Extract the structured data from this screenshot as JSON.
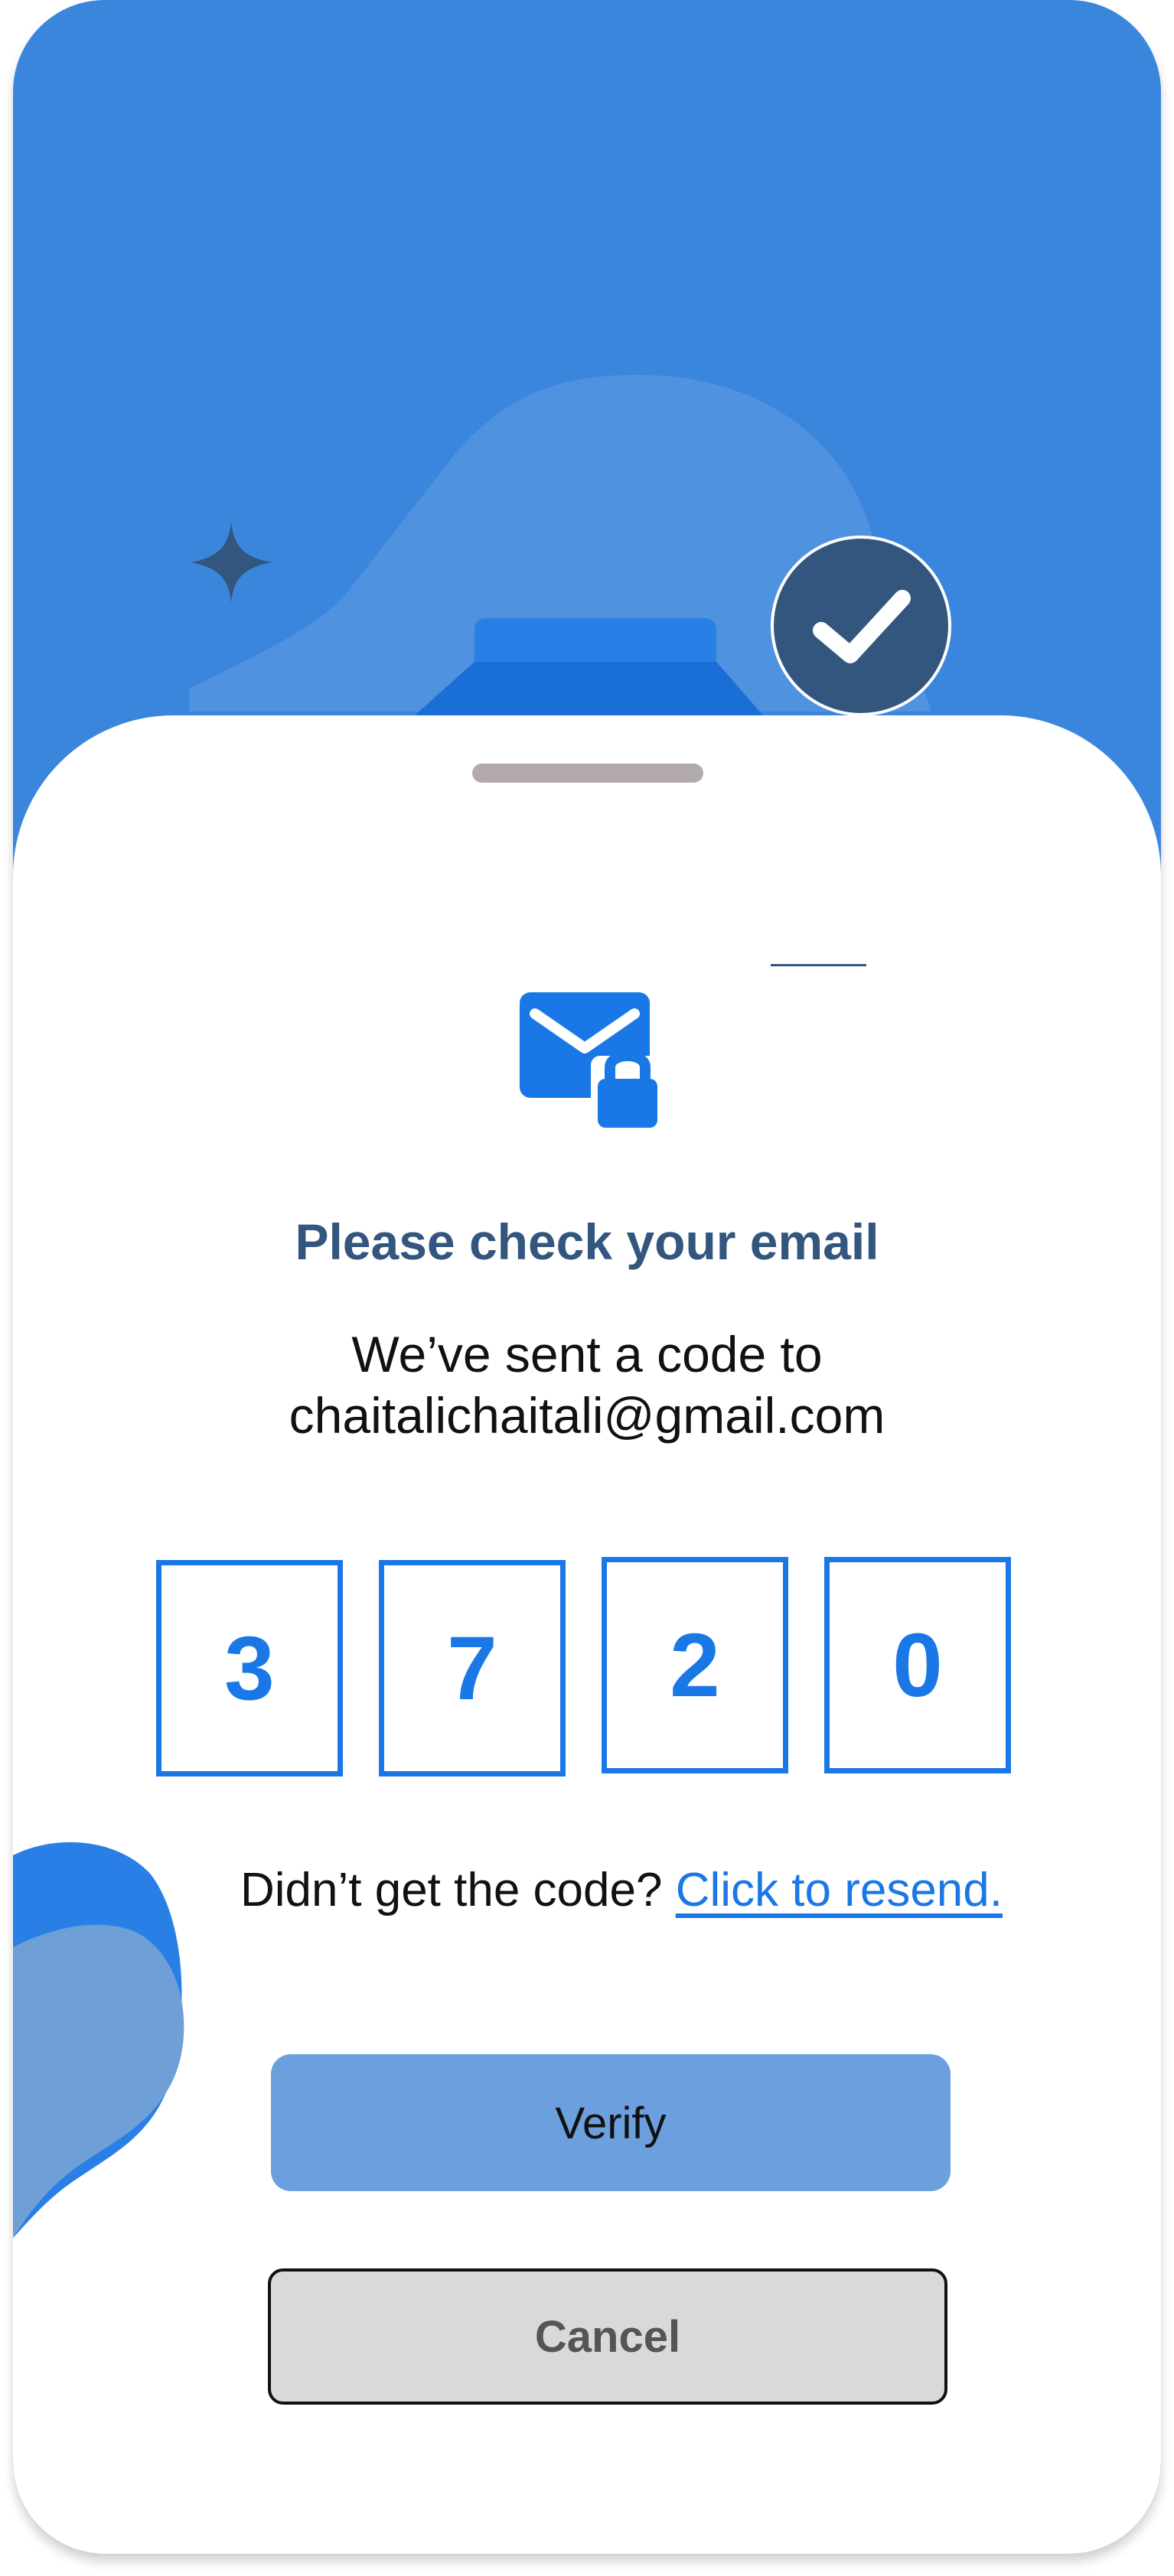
{
  "screen": {
    "title": "Please check your email",
    "subtitle_line1": "We’ve sent a code to",
    "email": "chaitalichaitali@gmail.com"
  },
  "code": {
    "digits": [
      "3",
      "7",
      "2",
      "0"
    ]
  },
  "resend": {
    "prompt": "Didn’t get the code?",
    "link_label": "Click to resend."
  },
  "actions": {
    "verify_label": "Verify",
    "cancel_label": "Cancel"
  },
  "icons": {
    "hero_sparkle": "sparkle-icon",
    "status_badge": "checkmark-icon",
    "mail": "mail-lock-icon"
  },
  "colors": {
    "hero_background": "#3a86dd",
    "primary_blue": "#1a78e6",
    "heading_navy": "#33567f",
    "verify_button": "#6b9fde",
    "cancel_button": "#d9d9d9"
  }
}
